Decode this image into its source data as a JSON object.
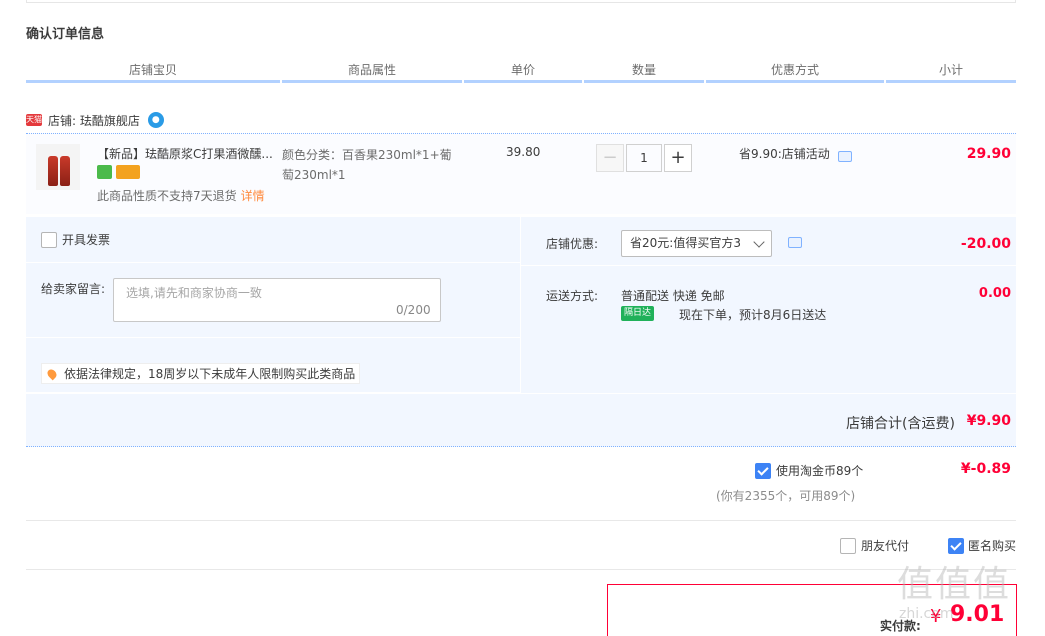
{
  "page": {
    "title": "确认订单信息"
  },
  "columns": [
    "店铺宝贝",
    "商品属性",
    "单价",
    "数量",
    "优惠方式",
    "小计"
  ],
  "shop": {
    "badge": "天猫",
    "name": "店铺: 珐酷旗舰店"
  },
  "item": {
    "name": "【新品】珐酷原浆C打果酒微醺...",
    "attr": "颜色分类：百香果230ml*1+葡萄230ml*1",
    "note": "此商品性质不支持7天退货",
    "detail_link": "详情",
    "price": "39.80",
    "quantity": "1",
    "promo": "省9.90:店铺活动",
    "subtotal": "29.90"
  },
  "invoice": {
    "label": "开具发票",
    "checked": false
  },
  "message": {
    "label": "给卖家留言:",
    "placeholder": "选填,请先和商家协商一致",
    "counter": "0/200"
  },
  "law_notice": "依据法律规定，18周岁以下未成年人限制购买此类商品",
  "shop_discount": {
    "label": "店铺优惠:",
    "selected": "省20元:值得买官方3",
    "value": "-20.00"
  },
  "shipping": {
    "label": "运送方式:",
    "method": "普通配送 快递 免邮",
    "badge": "隔日达",
    "eta": "现在下单，预计8月6日送达",
    "fee": "0.00"
  },
  "shop_total": {
    "label": "店铺合计(含运费)",
    "value": "¥9.90"
  },
  "coins": {
    "label": "使用淘金币89个",
    "checked": true,
    "value": "¥-0.89",
    "note": "(你有2355个，可用89个)"
  },
  "friend_pay": {
    "label": "朋友代付",
    "checked": false
  },
  "anonymous": {
    "label": "匿名购买",
    "checked": true
  },
  "payment": {
    "label": "实付款:",
    "yen": "¥",
    "value": "9.01"
  },
  "watermark": {
    "logo": "值值值",
    "url": "zhi.com"
  },
  "colors": {
    "accent": "#ff0036",
    "border_blue": "#b2d1ff",
    "panel": "#f2f7ff"
  }
}
